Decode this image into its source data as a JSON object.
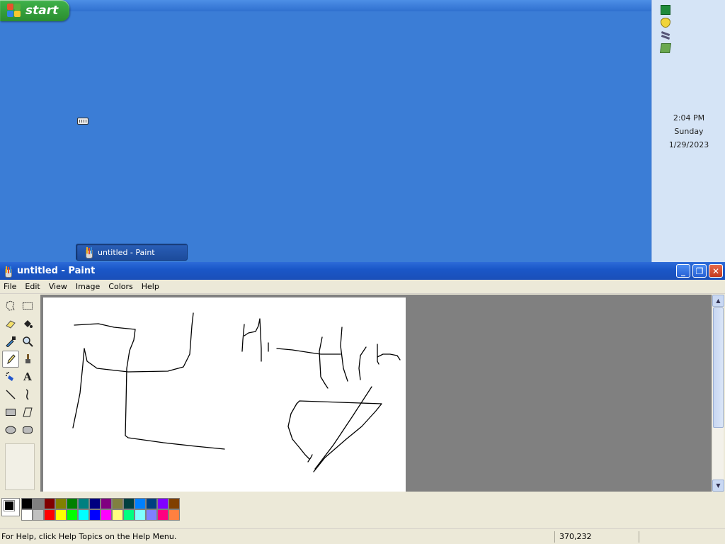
{
  "desktop": {
    "start_label": "start",
    "taskbar_button_label": "untitled - Paint"
  },
  "tray": {
    "time": "2:04 PM",
    "day": "Sunday",
    "date": "1/29/2023",
    "icons": [
      "network-tray-icon",
      "security-shield-icon",
      "wireless-icon",
      "safely-remove-hardware-icon"
    ]
  },
  "window": {
    "title": "untitled - Paint",
    "buttons": {
      "minimize": "_",
      "maximize": "❐",
      "close": "✕"
    },
    "menu": [
      "File",
      "Edit",
      "View",
      "Image",
      "Colors",
      "Help"
    ]
  },
  "toolbox": {
    "tools": [
      "free-form-select-icon",
      "rect-select-icon",
      "eraser-icon",
      "fill-icon",
      "pick-color-icon",
      "magnifier-icon",
      "pencil-icon",
      "brush-icon",
      "airbrush-icon",
      "text-icon",
      "line-icon",
      "curve-icon",
      "rectangle-icon",
      "polygon-icon",
      "ellipse-icon",
      "rounded-rectangle-icon"
    ],
    "active_tool": "pencil-icon"
  },
  "palette": {
    "foreground": "#000000",
    "background": "#ffffff",
    "colors": [
      "#000000",
      "#808080",
      "#800000",
      "#808000",
      "#008000",
      "#008080",
      "#000080",
      "#800080",
      "#808040",
      "#004040",
      "#0080ff",
      "#004080",
      "#8000ff",
      "#804000",
      "#ffffff",
      "#c0c0c0",
      "#ff0000",
      "#ffff00",
      "#00ff00",
      "#00ffff",
      "#0000ff",
      "#ff00ff",
      "#ffff80",
      "#00ff80",
      "#80ffff",
      "#8080ff",
      "#ff0080",
      "#ff8040"
    ]
  },
  "status": {
    "help_text": "For Help, click Help Topics on the Help Menu.",
    "coords": "370,232"
  }
}
